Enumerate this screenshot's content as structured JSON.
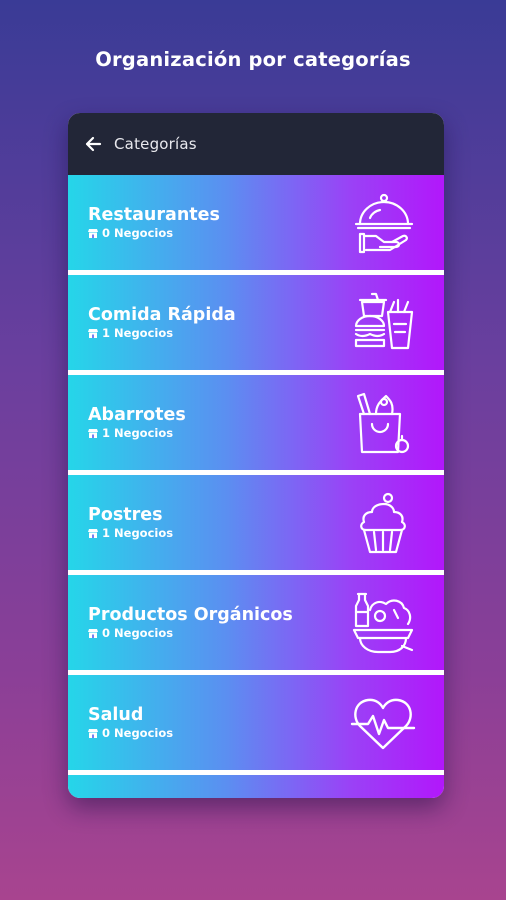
{
  "headline": "Organización por categorías",
  "appbar": {
    "title": "Categorías",
    "back_icon": "arrow-left-icon"
  },
  "colors": {
    "appbar": "#222637",
    "row_gradient_start": "#25d6e9",
    "row_gradient_end": "#b217fb",
    "text": "#ffffff"
  },
  "categories": [
    {
      "name": "Restaurantes",
      "count": "0",
      "count_label": "Negocios",
      "icon": "cloche-icon"
    },
    {
      "name": "Comida Rápida",
      "count": "1",
      "count_label": "Negocios",
      "icon": "fast-food-icon"
    },
    {
      "name": "Abarrotes",
      "count": "1",
      "count_label": "Negocios",
      "icon": "grocery-bag-icon"
    },
    {
      "name": "Postres",
      "count": "1",
      "count_label": "Negocios",
      "icon": "cupcake-icon"
    },
    {
      "name": "Productos Orgánicos",
      "count": "0",
      "count_label": "Negocios",
      "icon": "organic-produce-icon"
    },
    {
      "name": "Salud",
      "count": "0",
      "count_label": "Negocios",
      "icon": "heart-pulse-icon"
    }
  ]
}
